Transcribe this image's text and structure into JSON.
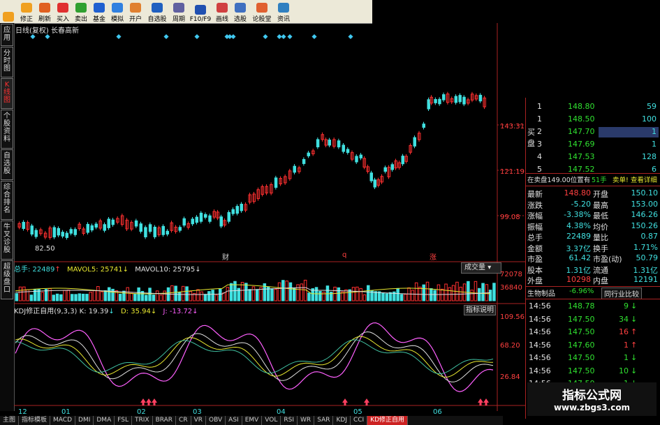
{
  "toolbar": {
    "buttons": [
      {
        "label": "",
        "icon": "arrow-left-icon",
        "color": "#f0a020"
      },
      {
        "label": "修正",
        "icon": "arrow-down-icon",
        "color": "#f0a020"
      },
      {
        "label": "刷新",
        "icon": "refresh-icon",
        "color": "#e06020"
      },
      {
        "label": "买入",
        "icon": "buy-icon",
        "color": "#e03030"
      },
      {
        "label": "卖出",
        "icon": "sell-icon",
        "color": "#30a030"
      },
      {
        "label": "基金",
        "icon": "fund-icon",
        "color": "#2060d0"
      },
      {
        "label": "模拟",
        "icon": "simulate-icon",
        "color": "#3080e0"
      },
      {
        "label": "开户",
        "icon": "account-icon",
        "color": "#e08030"
      },
      {
        "label": "自选股",
        "icon": "watchlist-icon",
        "color": "#2060c0"
      },
      {
        "label": "周期",
        "icon": "period-icon",
        "color": "#6060a0"
      },
      {
        "label": "F10/F9",
        "icon": "f10-icon",
        "color": "#2050b0"
      },
      {
        "label": "画线",
        "icon": "draw-line-icon",
        "color": "#d04040"
      },
      {
        "label": "选股",
        "icon": "select-stock-icon",
        "color": "#4070c0"
      },
      {
        "label": "论股堂",
        "icon": "forum-icon",
        "color": "#e06030"
      },
      {
        "label": "资讯",
        "icon": "news-icon",
        "color": "#3080c0"
      }
    ]
  },
  "left_tabs": [
    {
      "label": "应用"
    },
    {
      "label": "分时图"
    },
    {
      "label": "K线图",
      "active": true
    },
    {
      "label": "个股资料"
    },
    {
      "label": "自选股"
    },
    {
      "label": "综合排名"
    },
    {
      "label": "牛叉诊股"
    },
    {
      "label": "超级盘口"
    }
  ],
  "chart": {
    "title": "日线(复权)  长春高新",
    "price_ticks": [
      "143.31",
      "121.19",
      "99.08"
    ],
    "low_label": "82.50",
    "event_markers": [
      {
        "text": "财"
      },
      {
        "text": "q"
      },
      {
        "text": "涨"
      }
    ],
    "volume": {
      "total_label": "总手: 22489",
      "mavol5": "MAVOL5: 25741",
      "mavol10": "MAVOL10: 25795",
      "menu": "成交量",
      "ticks": [
        "72078",
        "36840"
      ]
    },
    "kdj": {
      "title": "KDJ修正自用(9,3,3)",
      "k": "K: 19.39",
      "d": "D: 35.94",
      "j": "J: -13.72",
      "help": "指标说明",
      "ticks": [
        "109.56",
        "68.20",
        "26.84"
      ]
    },
    "x_labels": [
      "12",
      "01",
      "02",
      "03",
      "04",
      "05",
      "06"
    ],
    "colors": {
      "up": "#ff3030",
      "down": "#40e0e0",
      "grid": "#aa2222",
      "k": "#e0e0e0",
      "d": "#e8e830",
      "j": "#ff60ff"
    }
  },
  "order_book": {
    "label_buy": "买盘",
    "rows": [
      {
        "n": "1",
        "price": "148.80",
        "vol": "59"
      },
      {
        "n": "1",
        "price": "148.50",
        "vol": "100"
      },
      {
        "n": "2",
        "price": "147.70",
        "vol": "1"
      },
      {
        "n": "3",
        "price": "147.69",
        "vol": "1"
      },
      {
        "n": "4",
        "price": "147.53",
        "vol": "128"
      },
      {
        "n": "5",
        "price": "147.52",
        "vol": "6"
      }
    ],
    "sell_info": "在卖盘149.00位置有",
    "sell_count": "51手",
    "sell_link": "卖单! 查看详细"
  },
  "quote": {
    "rows": [
      {
        "l1": "最新",
        "v1": "148.80",
        "l2": "开盘",
        "v2": "150.10"
      },
      {
        "l1": "涨跌",
        "v1": "-5.20",
        "l2": "最高",
        "v2": "153.00"
      },
      {
        "l1": "涨幅",
        "v1": "-3.38%",
        "l2": "最低",
        "v2": "146.26"
      },
      {
        "l1": "振幅",
        "v1": "4.38%",
        "l2": "均价",
        "v2": "150.26"
      },
      {
        "l1": "总手",
        "v1": "22489",
        "l2": "量比",
        "v2": "0.87"
      },
      {
        "l1": "金额",
        "v1": "3.37亿",
        "l2": "换手",
        "v2": "1.71%"
      },
      {
        "l1": "市盈",
        "v1": "61.42",
        "l2": "市盈(动)",
        "v2": "50.79"
      },
      {
        "l1": "股本",
        "v1": "1.31亿",
        "l2": "流通",
        "v2": "1.31亿"
      },
      {
        "l1": "外盘",
        "v1": "10298",
        "l2": "内盘",
        "v2": "12191"
      }
    ],
    "sector": "生物制品",
    "sector_change": "-6.96%",
    "compare": "同行业比较"
  },
  "ticks_list": [
    {
      "time": "14:56",
      "price": "148.78",
      "vol": "9",
      "dir": "down"
    },
    {
      "time": "14:56",
      "price": "147.50",
      "vol": "34",
      "dir": "down"
    },
    {
      "time": "14:56",
      "price": "147.50",
      "vol": "16",
      "dir": "up"
    },
    {
      "time": "14:56",
      "price": "147.60",
      "vol": "1",
      "dir": "up"
    },
    {
      "time": "14:56",
      "price": "147.50",
      "vol": "1",
      "dir": "down"
    },
    {
      "time": "14:56",
      "price": "147.50",
      "vol": "10",
      "dir": "down"
    },
    {
      "time": "14:56",
      "price": "147.50",
      "vol": "1",
      "dir": "down"
    }
  ],
  "bottom_tabs": [
    "主图",
    "指标模板",
    "MACD",
    "DMI",
    "DMA",
    "FSL",
    "TRIX",
    "BRAR",
    "CR",
    "VR",
    "OBV",
    "ASI",
    "EMV",
    "VOL",
    "RSI",
    "WR",
    "SAR",
    "KDJ",
    "CCI",
    "KD修正自用"
  ],
  "watermark": {
    "line1": "指标公式网",
    "line2": "www.zbgs3.com"
  }
}
